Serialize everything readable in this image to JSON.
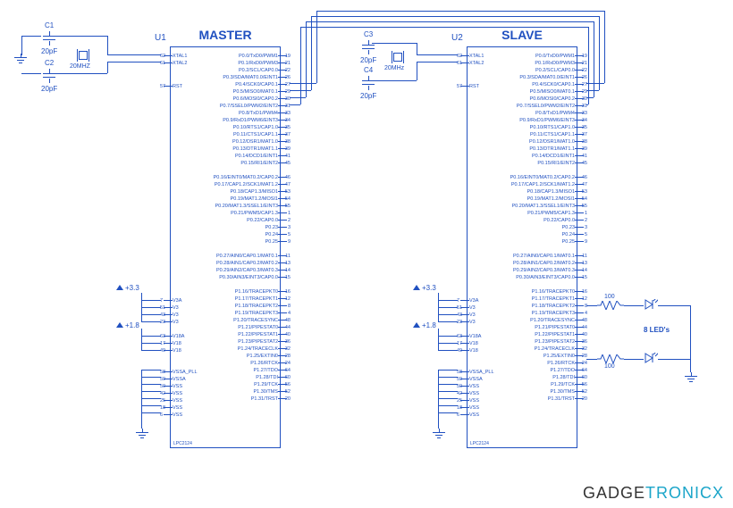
{
  "chips": [
    {
      "ref": "U1",
      "title": "MASTER",
      "part": "LPC2124"
    },
    {
      "ref": "U2",
      "title": "SLAVE",
      "part": "LPC2124"
    }
  ],
  "caps": [
    {
      "ref": "C1",
      "val": "20pF"
    },
    {
      "ref": "C2",
      "val": "20pF"
    },
    {
      "ref": "C3",
      "val": "20pF"
    },
    {
      "ref": "C4",
      "val": "20pF"
    }
  ],
  "xtals": [
    {
      "val": "20MHZ"
    },
    {
      "val": "20MHz"
    }
  ],
  "rails": [
    {
      "label": "+3.3"
    },
    {
      "label": "+1.8"
    },
    {
      "label": "+3.3"
    },
    {
      "label": "+1.8"
    }
  ],
  "resistors": [
    {
      "val": "100"
    },
    {
      "val": "100"
    }
  ],
  "led_note": "8 LED's",
  "brand": {
    "a": "GADGE",
    "b": "TRONICX"
  },
  "pins_right": [
    {
      "n": "19",
      "l": "P0.0/TxD0/PWM1"
    },
    {
      "n": "21",
      "l": "P0.1/RxD0/PWM3"
    },
    {
      "n": "22",
      "l": "P0.2/SCL/CAP0.0"
    },
    {
      "n": "26",
      "l": "P0.3/SDA/MAT0.0/EINT1"
    },
    {
      "n": "27",
      "l": "P0.4/SCK0/CAP0.1"
    },
    {
      "n": "29",
      "l": "P0.5/MISO0/MAT0.1"
    },
    {
      "n": "30",
      "l": "P0.6/MOSI0/CAP0.2"
    },
    {
      "n": "31",
      "l": "P0.7/SSEL0/PWM2/EINT2"
    },
    {
      "n": "33",
      "l": "P0.8/TxD1/PWM4"
    },
    {
      "n": "34",
      "l": "P0.9/RxD1/PWM6/EINT3"
    },
    {
      "n": "35",
      "l": "P0.10/RTS1/CAP1.0"
    },
    {
      "n": "37",
      "l": "P0.11/CTS1/CAP1.1"
    },
    {
      "n": "38",
      "l": "P0.12/DSR1/MAT1.0"
    },
    {
      "n": "39",
      "l": "P0.13/DTR1/MAT1.1"
    },
    {
      "n": "41",
      "l": "P0.14/DCD1/EINT1"
    },
    {
      "n": "45",
      "l": "P0.15/RI1/EINT2"
    },
    {
      "gap": true
    },
    {
      "n": "46",
      "l": "P0.16/EINT0/MAT0.2/CAP0.2"
    },
    {
      "n": "47",
      "l": "P0.17/CAP1.2/SCK1/MAT1.2"
    },
    {
      "n": "53",
      "l": "P0.18/CAP1.3/MISO1"
    },
    {
      "n": "54",
      "l": "P0.19/MAT1.2/MOSI1"
    },
    {
      "n": "55",
      "l": "P0.20/MAT1.3/SSEL1/EINT3"
    },
    {
      "n": "1",
      "l": "P0.21/PWM5/CAP1.3"
    },
    {
      "n": "2",
      "l": "P0.22/CAP0.0"
    },
    {
      "n": "3",
      "l": "P0.23"
    },
    {
      "n": "5",
      "l": "P0.24"
    },
    {
      "n": "9",
      "l": "P0.25"
    },
    {
      "gap": true
    },
    {
      "n": "11",
      "l": "P0.27/AIN0/CAP0.1/MAT0.1"
    },
    {
      "n": "13",
      "l": "P0.28/AIN1/CAP0.2/MAT0.2"
    },
    {
      "n": "14",
      "l": "P0.29/AIN2/CAP0.3/MAT0.3"
    },
    {
      "n": "15",
      "l": "P0.30/AIN3/EINT3/CAP0.0"
    },
    {
      "gap": true
    },
    {
      "n": "16",
      "l": "P1.16/TRACEPKT0"
    },
    {
      "n": "12",
      "l": "P1.17/TRACEPKT1"
    },
    {
      "n": "8",
      "l": "P1.18/TRACEPKT2"
    },
    {
      "n": "4",
      "l": "P1.19/TRACEPKT3"
    },
    {
      "n": "48",
      "l": "P1.20/TRACESYNC"
    },
    {
      "n": "44",
      "l": "P1.21/PIPESTAT0"
    },
    {
      "n": "40",
      "l": "P1.22/PIPESTAT1"
    },
    {
      "n": "36",
      "l": "P1.23/PIPESTAT2"
    },
    {
      "n": "32",
      "l": "P1.24/TRACECLK"
    },
    {
      "n": "28",
      "l": "P1.25/EXTIN0"
    },
    {
      "n": "24",
      "l": "P1.26/RTCK"
    },
    {
      "n": "64",
      "l": "P1.27/TDO"
    },
    {
      "n": "60",
      "l": "P1.28/TDI"
    },
    {
      "n": "56",
      "l": "P1.29/TCK"
    },
    {
      "n": "52",
      "l": "P1.30/TMS"
    },
    {
      "n": "20",
      "l": "P1.31/TRST"
    }
  ],
  "pins_left_top": [
    {
      "n": "62",
      "l": "XTAL1"
    },
    {
      "n": "61",
      "l": "XTAL2"
    }
  ],
  "pins_left_rst": [
    {
      "n": "57",
      "l": "RST"
    }
  ],
  "pins_left_v3": [
    {
      "n": "7",
      "l": "V3A"
    },
    {
      "n": "51",
      "l": "V3"
    },
    {
      "n": "43",
      "l": "V3"
    },
    {
      "n": "23",
      "l": "V3"
    }
  ],
  "pins_left_v18": [
    {
      "n": "63",
      "l": "V18A"
    },
    {
      "n": "17",
      "l": "V18"
    },
    {
      "n": "49",
      "l": "V18"
    }
  ],
  "pins_left_vss": [
    {
      "n": "58",
      "l": "VSSA_PLL"
    },
    {
      "n": "59",
      "l": "VSSA"
    },
    {
      "n": "50",
      "l": "VSS"
    },
    {
      "n": "42",
      "l": "VSS"
    },
    {
      "n": "25",
      "l": "VSS"
    },
    {
      "n": "18",
      "l": "VSS"
    },
    {
      "n": "6",
      "l": "VSS"
    }
  ]
}
